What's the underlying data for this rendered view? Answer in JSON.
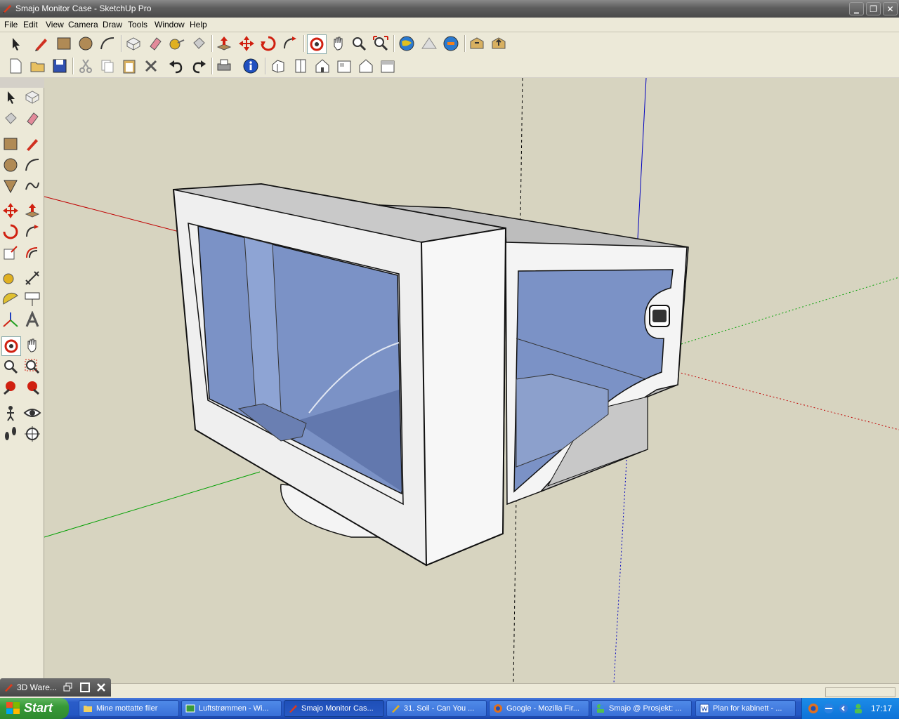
{
  "window": {
    "title": "Smajo Monitor Case - SketchUp Pro",
    "minimize": "‗",
    "restore": "❐",
    "close": "✕"
  },
  "menu": [
    "File",
    "Edit",
    "View",
    "Camera",
    "Draw",
    "Tools",
    "Window",
    "Help"
  ],
  "minimized_window": {
    "title": "3D Ware..."
  },
  "taskbar": {
    "start": "Start",
    "tasks": [
      {
        "label": "Mine mottatte filer",
        "icon": "folder-icon"
      },
      {
        "label": "Luftstrømmen - Wi...",
        "icon": "image-viewer-icon"
      },
      {
        "label": "Smajo Monitor Cas...",
        "icon": "sketchup-icon",
        "active": true
      },
      {
        "label": "31. Soil - Can You ...",
        "icon": "media-icon"
      },
      {
        "label": "Google - Mozilla Fir...",
        "icon": "firefox-icon"
      },
      {
        "label": "Smajo @ Prosjekt: ...",
        "icon": "messenger-icon"
      },
      {
        "label": "Plan for kabinett - ...",
        "icon": "word-icon"
      }
    ],
    "clock": "17:17"
  },
  "colors": {
    "viewport_bg": "#d7d4c0",
    "glass": "#7a90c4",
    "case": "#eeeeee",
    "axis_red": "#c00000",
    "axis_green": "#00a000",
    "axis_blue": "#0000c0"
  }
}
